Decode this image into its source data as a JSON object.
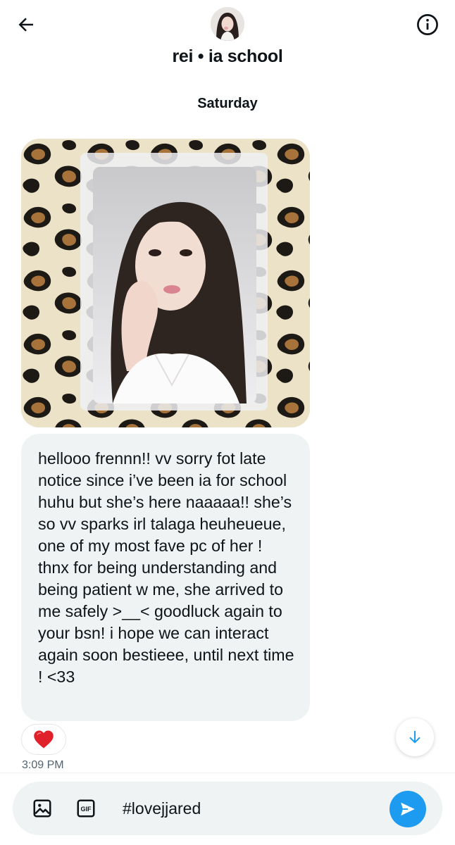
{
  "header": {
    "title": "rei • ia school",
    "back_icon": "arrow-left-icon",
    "info_icon": "info-circle-icon"
  },
  "thread": {
    "day_label": "Saturday",
    "messages": [
      {
        "type": "image",
        "content": "photocard in sleeve on leopard print fabric"
      },
      {
        "type": "text",
        "text": "hellooo frennn!! vv sorry fot late notice since i’ve been ia for school huhu but she’s here naaaaa!! she’s so vv sparks irl talaga heuheueue, one of my most fave pc of her ! thnx for being understanding and being patient w me, she arrived to me safely >__< goodluck again to your bsn! i hope we can interact again soon bestieee, until next time ! <33",
        "reaction": "❤️",
        "time": "3:09 PM"
      }
    ]
  },
  "composer": {
    "value": "#lovejjared",
    "media_icon": "image-icon",
    "gif_icon": "gif-icon",
    "send_icon": "send-icon"
  },
  "colors": {
    "accent": "#1d9bf0",
    "bubble": "#eff3f4",
    "muted_text": "#536471"
  }
}
